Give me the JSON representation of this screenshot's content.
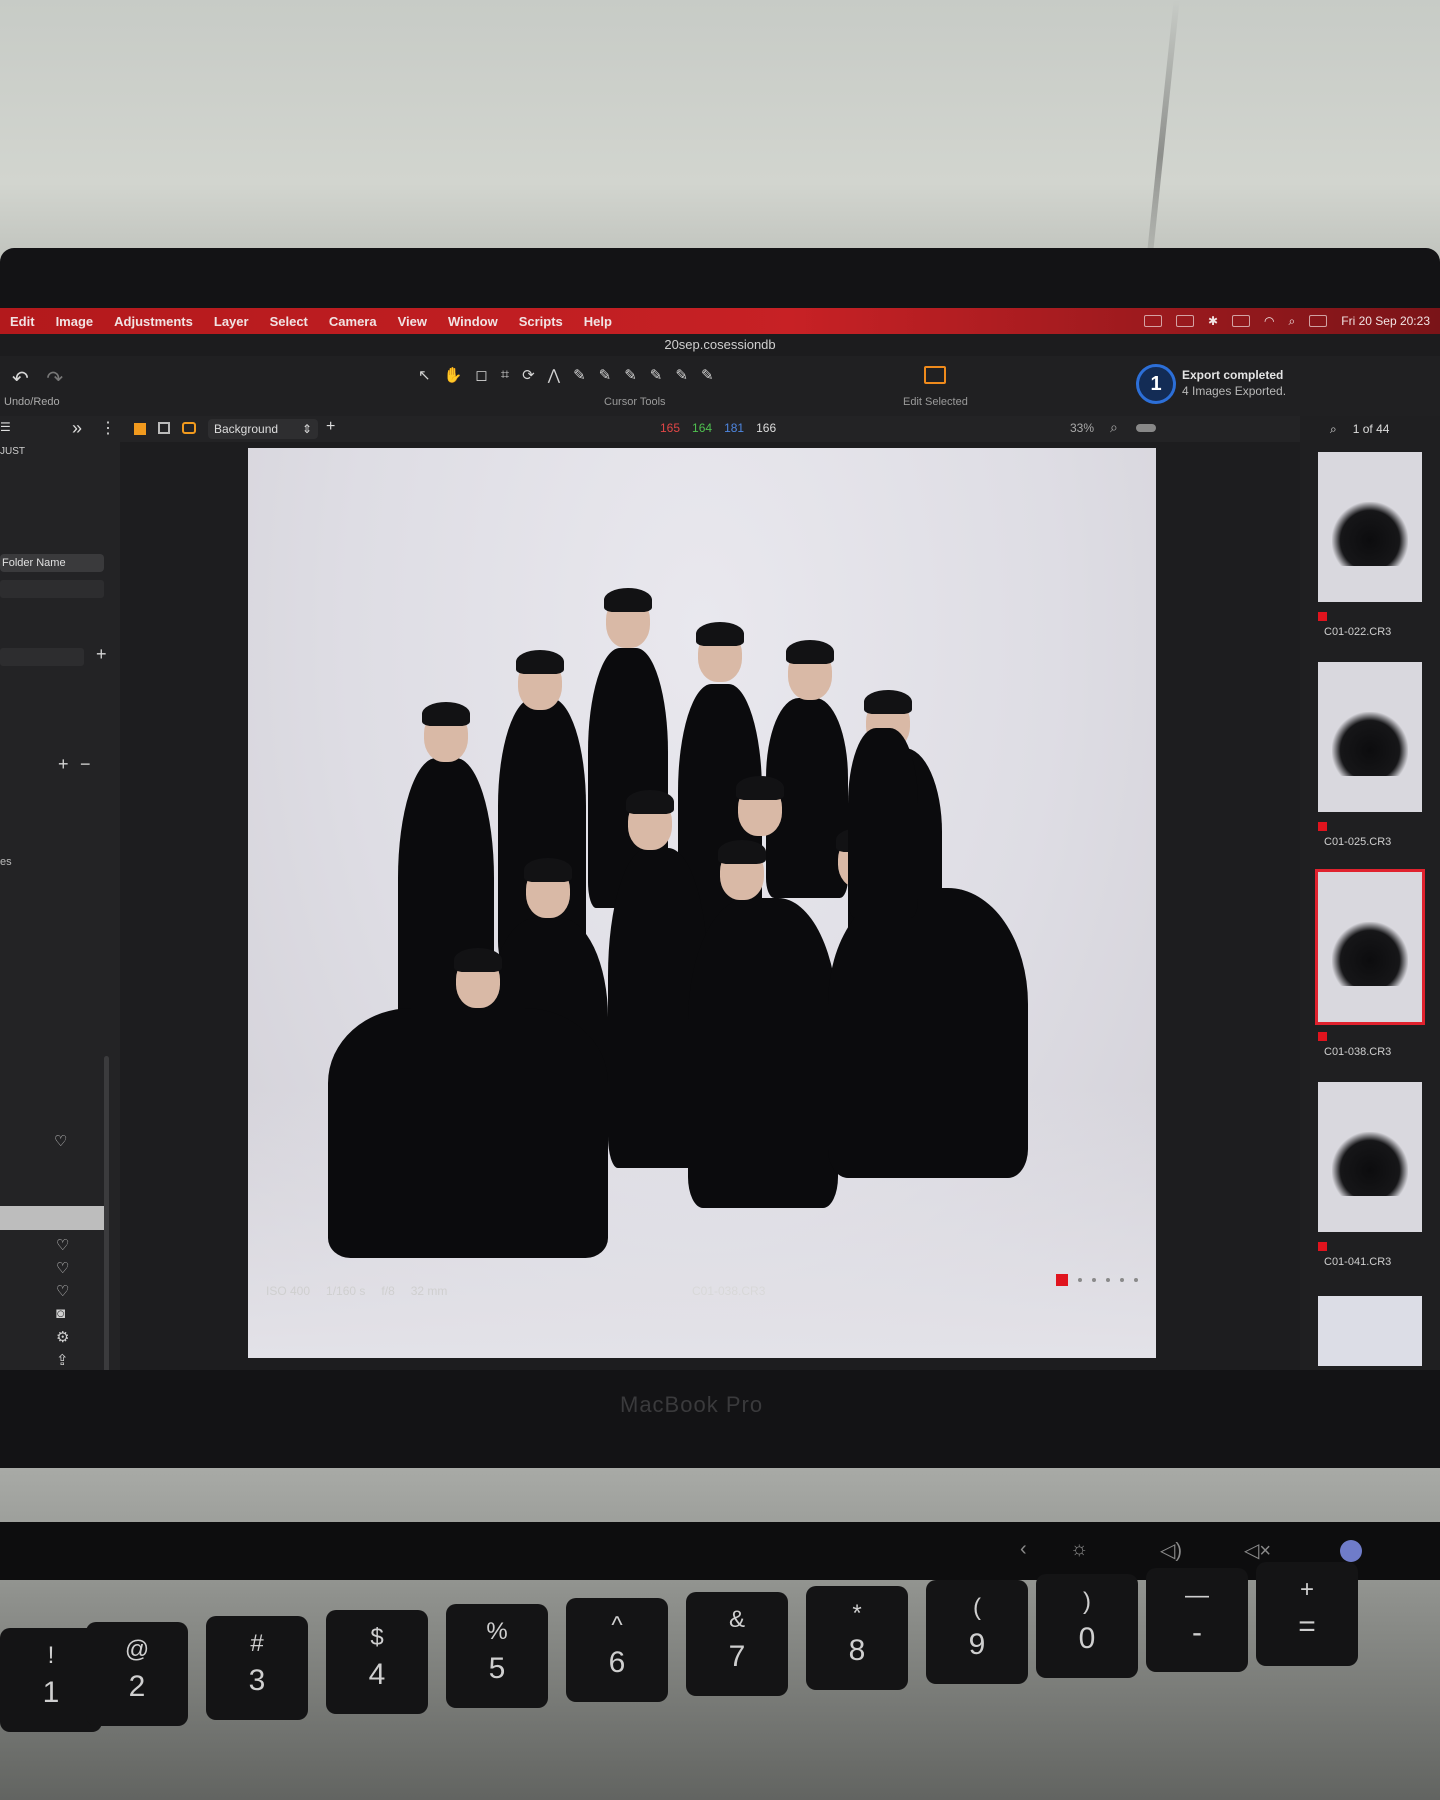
{
  "menubar": {
    "items": [
      "Edit",
      "Image",
      "Adjustments",
      "Layer",
      "Select",
      "Camera",
      "View",
      "Window",
      "Scripts",
      "Help"
    ],
    "clock": "Fri 20 Sep  20:23"
  },
  "window": {
    "title": "20sep.cosessiondb"
  },
  "toolbar": {
    "undo_label": "Undo/Redo",
    "cursor_tools_label": "Cursor Tools",
    "cursor_tools": [
      "↖",
      "✋",
      "◻",
      "⌗",
      "⟳",
      "⋀",
      "✎",
      "✎",
      "✎",
      "✎",
      "✎",
      "✎"
    ],
    "edit_selected_label": "Edit Selected",
    "export_badge": "1",
    "export_title": "Export completed",
    "export_subtitle": "4 Images Exported."
  },
  "left_panel": {
    "header": "JUST",
    "folder_pill": "Folder Name",
    "side_label": "es"
  },
  "viewer": {
    "layer": "Background",
    "rgb": {
      "r": "165",
      "g": "164",
      "b": "181",
      "l": "166"
    },
    "zoom": "33%",
    "filename": "C01-038.CR3",
    "exif": {
      "iso": "ISO 400",
      "shutter": "1/160 s",
      "aperture": "f/8",
      "focal": "32 mm"
    }
  },
  "browser": {
    "count": "1 of 44",
    "thumbs": [
      {
        "name": "C01-022.CR3",
        "selected": false
      },
      {
        "name": "C01-025.CR3",
        "selected": false
      },
      {
        "name": "C01-038.CR3",
        "selected": true
      },
      {
        "name": "C01-041.CR3",
        "selected": false
      }
    ]
  },
  "laptop": {
    "brand": "MacBook Pro",
    "keys": [
      {
        "top": "!",
        "bottom": "1"
      },
      {
        "top": "@",
        "bottom": "2"
      },
      {
        "top": "#",
        "bottom": "3"
      },
      {
        "top": "$",
        "bottom": "4"
      },
      {
        "top": "%",
        "bottom": "5"
      },
      {
        "top": "^",
        "bottom": "6"
      },
      {
        "top": "&",
        "bottom": "7"
      },
      {
        "top": "*",
        "bottom": "8"
      },
      {
        "top": "(",
        "bottom": "9"
      },
      {
        "top": ")",
        "bottom": "0"
      },
      {
        "top": "—",
        "bottom": "-"
      },
      {
        "top": "+",
        "bottom": "="
      }
    ]
  },
  "colors": {
    "menubar": "#c72125",
    "accent": "#f19a1e",
    "flag": "#e0141e",
    "badge": "#2c6fd8"
  }
}
